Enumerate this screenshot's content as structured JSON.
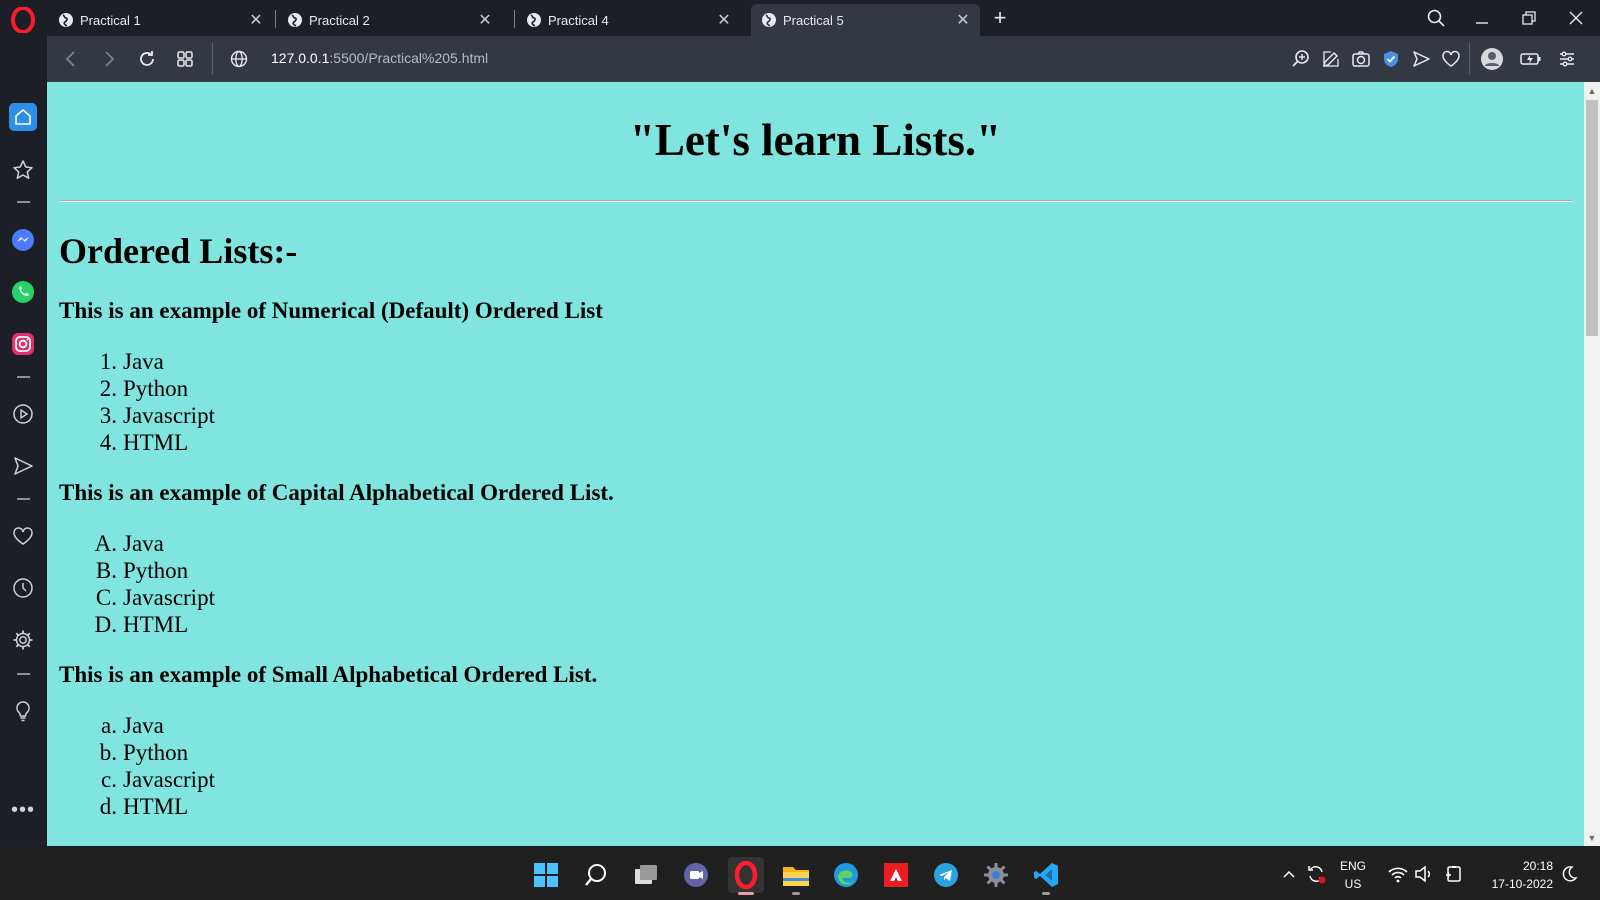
{
  "browser": {
    "tabs": [
      {
        "label": "Practical 1",
        "active": false
      },
      {
        "label": "Practical 2",
        "active": false
      },
      {
        "label": "Practical 4",
        "active": false
      },
      {
        "label": "Practical 5",
        "active": true
      }
    ],
    "url_host": "127.0.0.1",
    "url_rest": ":5500/Practical%205.html"
  },
  "page": {
    "title": "\"Let's learn Lists.\"",
    "section_heading": "Ordered Lists:-",
    "lists": [
      {
        "heading": "This is an example of Numerical (Default) Ordered List",
        "markers": [
          "1.",
          "2.",
          "3.",
          "4."
        ],
        "items": [
          "Java",
          "Python",
          "Javascript",
          "HTML"
        ]
      },
      {
        "heading": "This is an example of Capital Alphabetical Ordered List.",
        "markers": [
          "A.",
          "B.",
          "C.",
          "D."
        ],
        "items": [
          "Java",
          "Python",
          "Javascript",
          "HTML"
        ]
      },
      {
        "heading": "This is an example of Small Alphabetical Ordered List.",
        "markers": [
          "a.",
          "b.",
          "c.",
          "d."
        ],
        "items": [
          "Java",
          "Python",
          "Javascript",
          "HTML"
        ]
      }
    ],
    "background_color": "#81e5df"
  },
  "taskbar": {
    "lang_top": "ENG",
    "lang_bottom": "US",
    "time": "20:18",
    "date": "17-10-2022"
  }
}
